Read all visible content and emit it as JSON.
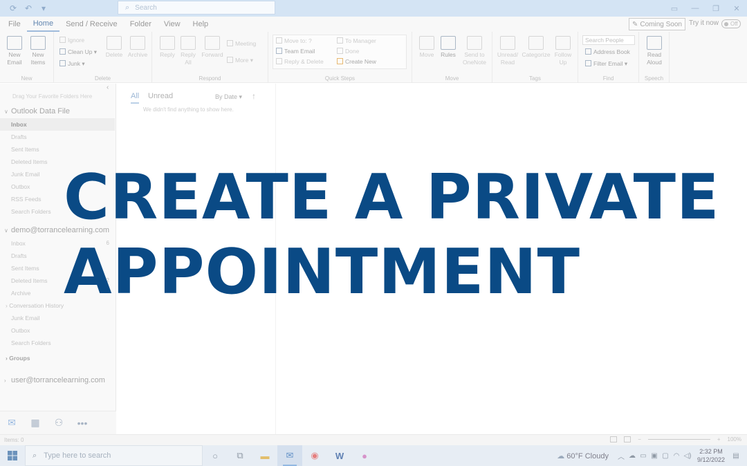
{
  "titlebar": {
    "search_placeholder": "Search"
  },
  "menu": {
    "items": [
      "File",
      "Home",
      "Send / Receive",
      "Folder",
      "View",
      "Help"
    ],
    "active": "Home",
    "coming_soon": "Coming Soon",
    "try_it_now": "Try it now",
    "toggle_state": "Off"
  },
  "ribbon": {
    "new_email": "New Email",
    "new_items": "New Items",
    "group_new": "New",
    "ignore": "Ignore",
    "clean_up": "Clean Up",
    "junk": "Junk",
    "delete": "Delete",
    "archive": "Archive",
    "group_delete": "Delete",
    "reply": "Reply",
    "reply_all": "Reply All",
    "forward": "Forward",
    "meeting": "Meeting",
    "more": "More",
    "group_respond": "Respond",
    "qs_move_to": "Move to: ?",
    "qs_team_email": "Team Email",
    "qs_reply_delete": "Reply & Delete",
    "qs_to_manager": "To Manager",
    "qs_done": "Done",
    "qs_create_new": "Create New",
    "group_quick_steps": "Quick Steps",
    "move": "Move",
    "rules": "Rules",
    "send_to_onenote": "Send to OneNote",
    "group_move": "Move",
    "unread_read": "Unread/ Read",
    "categorize": "Categorize",
    "follow_up": "Follow Up",
    "group_tags": "Tags",
    "search_people": "Search People",
    "address_book": "Address Book",
    "filter_email": "Filter Email",
    "group_find": "Find",
    "read_aloud": "Read Aloud",
    "group_speech": "Speech"
  },
  "folders": {
    "fav_hint": "Drag Your Favorite Folders Here",
    "data_file": "Outlook Data File",
    "data_file_items": [
      "Inbox",
      "Drafts",
      "Sent Items",
      "Deleted Items",
      "Junk Email",
      "Outbox",
      "RSS Feeds",
      "Search Folders"
    ],
    "account": "demo@torrancelearning.com",
    "account_items": [
      "Inbox",
      "Drafts",
      "Sent Items",
      "Deleted Items",
      "Archive",
      "Conversation History",
      "Junk Email",
      "Outbox",
      "Search Folders"
    ],
    "inbox_count": "6",
    "deleted_count": "2",
    "groups": "Groups",
    "user_account": "user@torrancelearning.com"
  },
  "messages": {
    "tab_all": "All",
    "tab_unread": "Unread",
    "sort": "By Date",
    "empty": "We didn't find anything to show here."
  },
  "status": {
    "items": "Items: 0",
    "zoom": "100%"
  },
  "taskbar": {
    "search_placeholder": "Type here to search",
    "weather": "60°F  Cloudy",
    "time": "2:32 PM",
    "date": "9/12/2022"
  },
  "overlay": {
    "line1": "CREATE A PRIVATE",
    "line2": "APPOINTMENT",
    "color": "#0a4a85"
  }
}
